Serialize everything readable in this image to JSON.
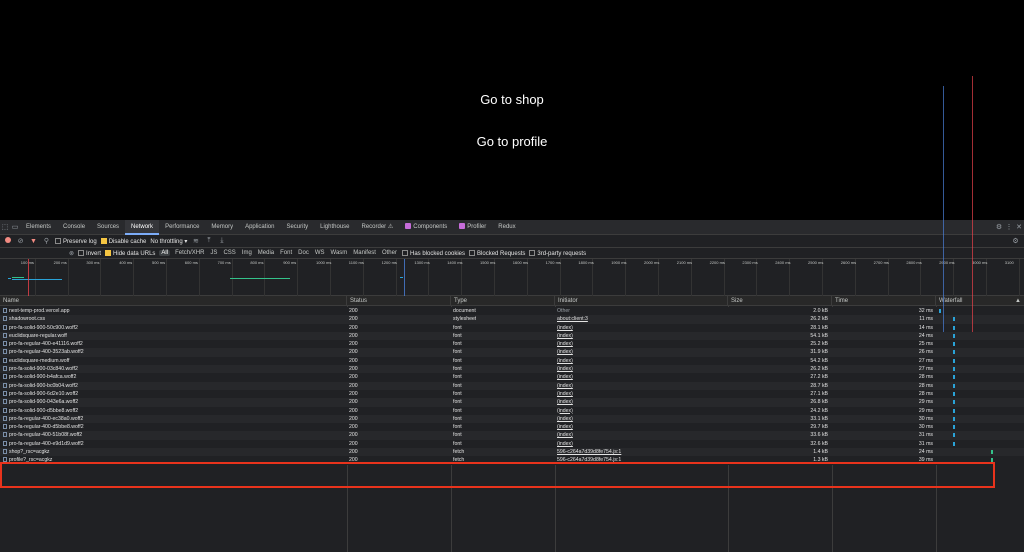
{
  "page": {
    "links": [
      "Go to shop",
      "Go to profile"
    ]
  },
  "devtools": {
    "tabs": [
      "Elements",
      "Console",
      "Sources",
      "Network",
      "Performance",
      "Memory",
      "Application",
      "Security",
      "Lighthouse",
      "Recorder ⚠",
      "Components",
      "Profiler",
      "Redux"
    ],
    "active_tab": "Network",
    "toolbar": {
      "preserve_log": "Preserve log",
      "disable_cache": "Disable cache",
      "throttling": "No throttling"
    },
    "filter": {
      "value": "",
      "invert": "Invert",
      "hide_data_urls": "Hide data URLs",
      "types": [
        "All",
        "Fetch/XHR",
        "JS",
        "CSS",
        "Img",
        "Media",
        "Font",
        "Doc",
        "WS",
        "Wasm",
        "Manifest",
        "Other"
      ],
      "active_type": "All",
      "has_blocked_cookies": "Has blocked cookies",
      "blocked_requests": "Blocked Requests",
      "third_party": "3rd-party requests"
    },
    "overview_ticks": [
      "100 ms",
      "200 ms",
      "300 ms",
      "400 ms",
      "500 ms",
      "600 ms",
      "700 ms",
      "800 ms",
      "900 ms",
      "1000 ms",
      "1100 ms",
      "1200 ms",
      "1300 ms",
      "1400 ms",
      "1500 ms",
      "1600 ms",
      "1700 ms",
      "1800 ms",
      "1900 ms",
      "2000 ms",
      "2100 ms",
      "2200 ms",
      "2300 ms",
      "2400 ms",
      "2500 ms",
      "2600 ms",
      "2700 ms",
      "2800 ms",
      "2900 ms",
      "3000 ms",
      "3100"
    ],
    "columns": {
      "name": "Name",
      "status": "Status",
      "type": "Type",
      "initiator": "Initiator",
      "size": "Size",
      "time": "Time",
      "waterfall": "Waterfall"
    },
    "rows": [
      {
        "name": "next-temp-prod.vercel.app",
        "status": "200",
        "type": "document",
        "initiator": "Other",
        "size": "2.0 kB",
        "time": "32 ms",
        "wf": 0.01
      },
      {
        "name": "shadowroot.css",
        "status": "200",
        "type": "stylesheet",
        "initiator": "about:client:3",
        "size": "26.2 kB",
        "time": "11 ms",
        "wf": 0.18
      },
      {
        "name": "pro-fa-solid-900-50c900.woff2",
        "status": "200",
        "type": "font",
        "initiator": "(index)",
        "size": "28.1 kB",
        "time": "14 ms",
        "wf": 0.18
      },
      {
        "name": "euclidsquare-regular.woff",
        "status": "200",
        "type": "font",
        "initiator": "(index)",
        "size": "54.1 kB",
        "time": "24 ms",
        "wf": 0.18
      },
      {
        "name": "pro-fa-regular-400-e41116.woff2",
        "status": "200",
        "type": "font",
        "initiator": "(index)",
        "size": "25.2 kB",
        "time": "25 ms",
        "wf": 0.18
      },
      {
        "name": "pro-fa-regular-400-3523ab.woff2",
        "status": "200",
        "type": "font",
        "initiator": "(index)",
        "size": "31.9 kB",
        "time": "26 ms",
        "wf": 0.18
      },
      {
        "name": "euclidsquare-medium.woff",
        "status": "200",
        "type": "font",
        "initiator": "(index)",
        "size": "54.2 kB",
        "time": "27 ms",
        "wf": 0.18
      },
      {
        "name": "pro-fa-solid-900-03c840.woff2",
        "status": "200",
        "type": "font",
        "initiator": "(index)",
        "size": "26.2 kB",
        "time": "27 ms",
        "wf": 0.18
      },
      {
        "name": "pro-fa-solid-900-b4afca.woff2",
        "status": "200",
        "type": "font",
        "initiator": "(index)",
        "size": "27.2 kB",
        "time": "28 ms",
        "wf": 0.18
      },
      {
        "name": "pro-fa-solid-900-bc0b04.woff2",
        "status": "200",
        "type": "font",
        "initiator": "(index)",
        "size": "28.7 kB",
        "time": "28 ms",
        "wf": 0.18
      },
      {
        "name": "pro-fa-solid-900-6d2e10.woff2",
        "status": "200",
        "type": "font",
        "initiator": "(index)",
        "size": "27.1 kB",
        "time": "28 ms",
        "wf": 0.18
      },
      {
        "name": "pro-fa-solid-900-043e6a.woff2",
        "status": "200",
        "type": "font",
        "initiator": "(index)",
        "size": "26.8 kB",
        "time": "29 ms",
        "wf": 0.18
      },
      {
        "name": "pro-fa-solid-900-d5bbe8.woff2",
        "status": "200",
        "type": "font",
        "initiator": "(index)",
        "size": "24.2 kB",
        "time": "29 ms",
        "wf": 0.18
      },
      {
        "name": "pro-fa-regular-400-ec38a0.woff2",
        "status": "200",
        "type": "font",
        "initiator": "(index)",
        "size": "33.1 kB",
        "time": "30 ms",
        "wf": 0.18
      },
      {
        "name": "pro-fa-regular-400-d5bbe8.woff2",
        "status": "200",
        "type": "font",
        "initiator": "(index)",
        "size": "29.7 kB",
        "time": "30 ms",
        "wf": 0.18
      },
      {
        "name": "pro-fa-regular-400-51b08f.woff2",
        "status": "200",
        "type": "font",
        "initiator": "(index)",
        "size": "33.6 kB",
        "time": "31 ms",
        "wf": 0.18
      },
      {
        "name": "pro-fa-regular-400-e9d1d9.woff2",
        "status": "200",
        "type": "font",
        "initiator": "(index)",
        "size": "32.6 kB",
        "time": "31 ms",
        "wf": 0.18
      },
      {
        "name": "shop?_rsc=acgkz",
        "status": "200",
        "type": "fetch",
        "initiator": "596-c264a7d39d8fe754.js:1",
        "size": "1.4 kB",
        "time": "24 ms",
        "wf": 0.62
      },
      {
        "name": "profile?_rsc=acgkz",
        "status": "200",
        "type": "fetch",
        "initiator": "596-c264a7d39d8fe754.js:1",
        "size": "1.3 kB",
        "time": "39 ms",
        "wf": 0.62
      }
    ],
    "colors": {
      "accent": "#7cacf8",
      "highlight": "#e8331c",
      "waterfall_bar": "#2aa3d8",
      "waterfall_fetch": "#34c28a"
    }
  }
}
